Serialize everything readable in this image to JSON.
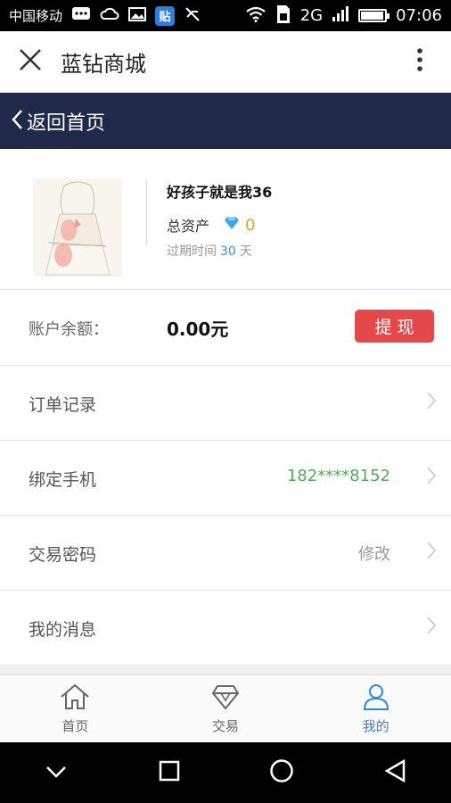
{
  "status_bar": {
    "carrier": "中国移动",
    "network": "2G",
    "time": "07:06",
    "tieba_label": "贴",
    "battery_level": 0.95,
    "icons": [
      "message-icon",
      "cloud-icon",
      "image-icon",
      "tieba-icon",
      "mute-icon",
      "wifi-icon",
      "sim-icon",
      "signal-icon",
      "battery-icon"
    ]
  },
  "header": {
    "title": "蓝钻商城",
    "close_icon": "close-icon",
    "more_icon": "more-vertical-icon"
  },
  "back_bar": {
    "label": "返回首页",
    "background": "#1f2a4a"
  },
  "profile": {
    "username": "好孩子就是我36",
    "assets_label": "总资产",
    "assets_value": "0",
    "expire_prefix": "过期时间",
    "expire_days": "30",
    "expire_suffix": "天"
  },
  "balance": {
    "label": "账户余额：",
    "value": "0.00元",
    "withdraw_label": "提现",
    "withdraw_color": "#e5484a"
  },
  "menu": [
    {
      "label": "订单记录",
      "value": ""
    },
    {
      "label": "绑定手机",
      "value": "182****8152"
    },
    {
      "label": "交易密码",
      "value": "修改"
    },
    {
      "label": "我的消息",
      "value": ""
    }
  ],
  "tabs": [
    {
      "label": "首页",
      "icon": "home-icon",
      "active": false
    },
    {
      "label": "交易",
      "icon": "diamond-icon",
      "active": false
    },
    {
      "label": "我的",
      "icon": "user-icon",
      "active": true
    }
  ],
  "colors": {
    "accent": "#2e88e0",
    "assets": "#f39a1f",
    "phone": "#4cb050"
  }
}
